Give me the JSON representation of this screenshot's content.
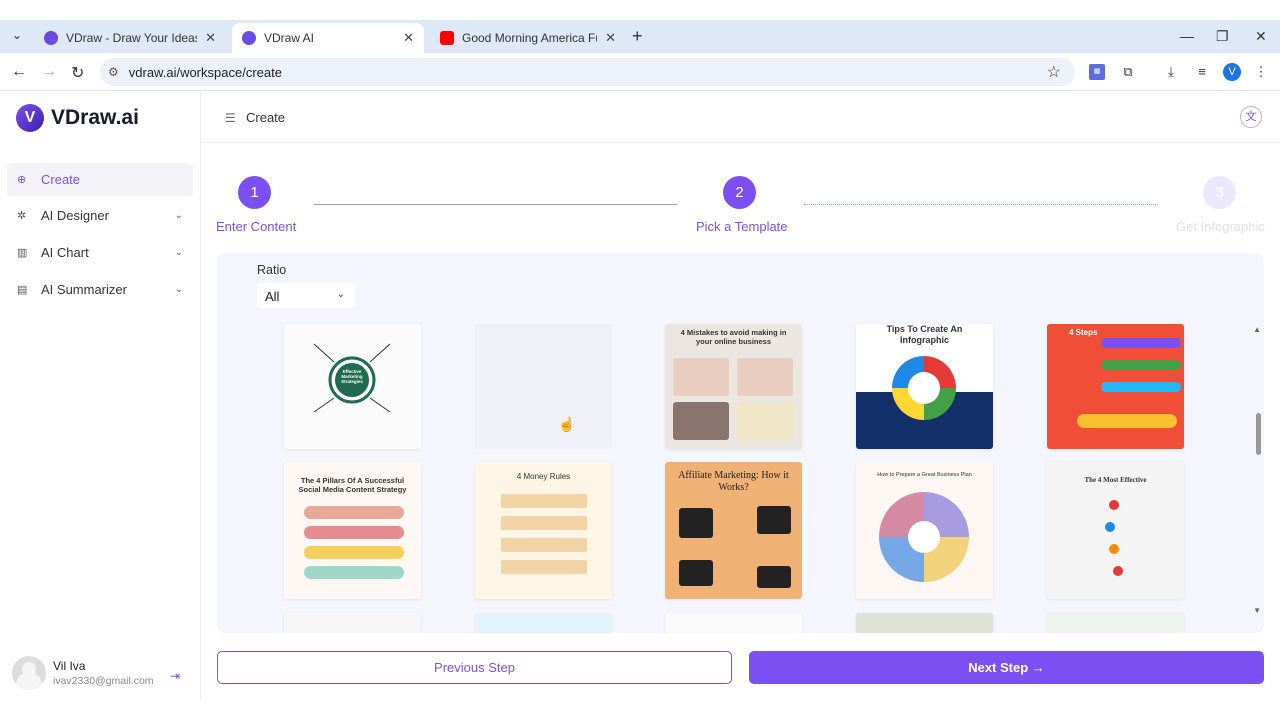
{
  "browser": {
    "tabs": [
      {
        "title": "VDraw - Draw Your Ideas Th",
        "favicon_color": "#6a4be6"
      },
      {
        "title": "VDraw AI",
        "favicon_color": "#6a4be6"
      },
      {
        "title": "Good Morning America Full",
        "favicon_color": "#ff0000"
      }
    ],
    "url": "vdraw.ai/workspace/create",
    "profile_initial": "V"
  },
  "app": {
    "brand": "VDraw.ai",
    "logo_letter": "V",
    "header_title": "Create",
    "accent": "#7b4ff2"
  },
  "sidebar": {
    "items": [
      {
        "label": "Create",
        "icon": "plus-circle-icon"
      },
      {
        "label": "AI Designer",
        "icon": "designer-icon"
      },
      {
        "label": "AI Chart",
        "icon": "chart-icon"
      },
      {
        "label": "AI Summarizer",
        "icon": "document-icon"
      }
    ],
    "user": {
      "name": "Vil Iva",
      "email": "ivav2330@gmail.com"
    }
  },
  "steps": [
    {
      "number": "1",
      "label": "Enter Content",
      "state": "done"
    },
    {
      "number": "2",
      "label": "Pick a Template",
      "state": "active"
    },
    {
      "number": "3",
      "label": "Get Infographic",
      "state": "pending"
    }
  ],
  "filter": {
    "label": "Ratio",
    "value": "All"
  },
  "templates": {
    "row1": [
      {
        "title": "Effective Marketing Strategies"
      },
      {
        "title": ""
      },
      {
        "title": "4 Mistakes to avoid making in your online business"
      },
      {
        "title": "Tips To Create An Infographic"
      },
      {
        "title": "4 Steps"
      }
    ],
    "row2": [
      {
        "title": "The 4 Pillars Of A Successful Social Media Content Strategy"
      },
      {
        "title": "4 Money Rules"
      },
      {
        "title": "Affiliate Marketing: How it Works?"
      },
      {
        "title": "How to Prepare a Great Business Plan"
      },
      {
        "title": "The 4 Most Effective"
      }
    ]
  },
  "buttons": {
    "previous": "Previous Step",
    "next": "Next Step →"
  }
}
